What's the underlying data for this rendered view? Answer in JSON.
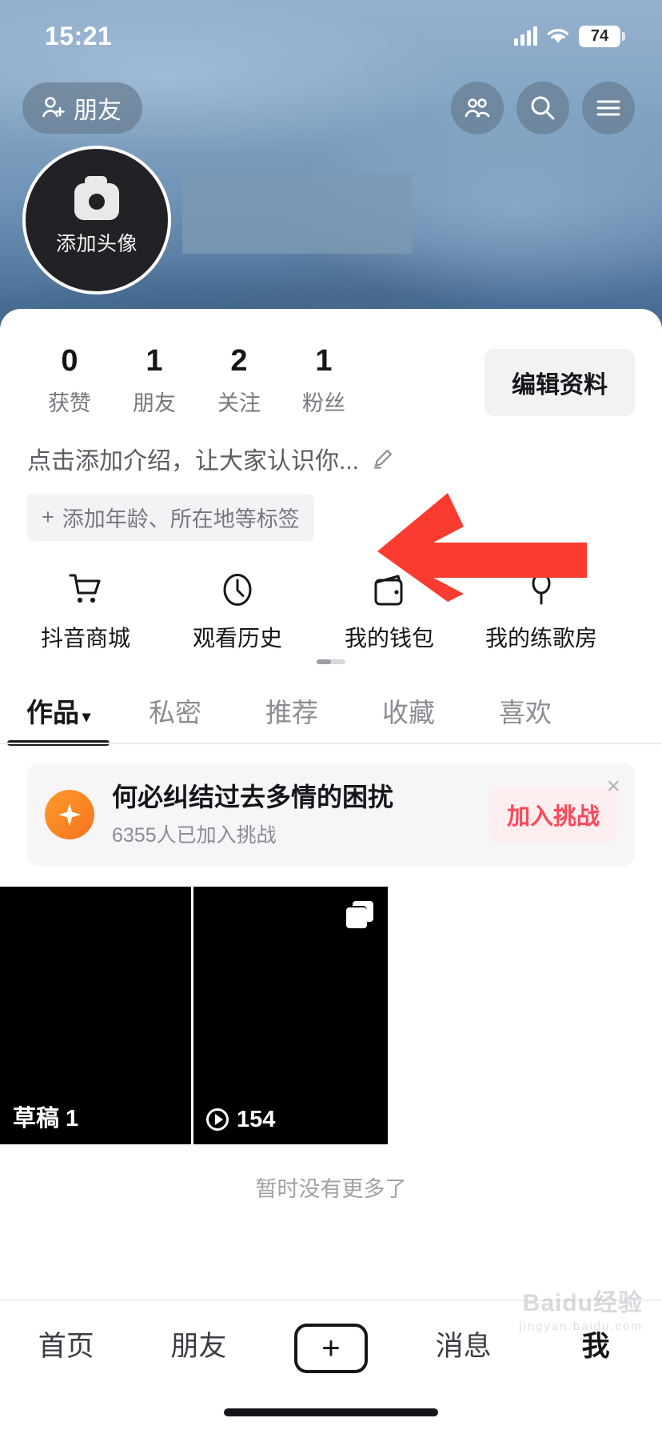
{
  "status_bar": {
    "time": "15:21",
    "battery_level": "74",
    "signal_icon": "cellular-signal-icon",
    "wifi_icon": "wifi-icon",
    "battery_icon": "battery-icon"
  },
  "top_bar": {
    "friend_button_label": "朋友",
    "friend_icon": "add-friend-icon",
    "contacts_icon": "contacts-icon",
    "search_icon": "search-icon",
    "menu_icon": "hamburger-menu-icon"
  },
  "profile": {
    "avatar_label": "添加头像",
    "avatar_icon": "camera-icon",
    "name_placeholder": "",
    "bio_text": "点击添加介绍，让大家认识你...",
    "bio_edit_icon": "pencil-icon",
    "tag_chip_label": "添加年龄、所在地等标签",
    "tag_chip_plus": "+",
    "edit_profile_label": "编辑资料",
    "stats": [
      {
        "value": "0",
        "label": "获赞"
      },
      {
        "value": "1",
        "label": "朋友"
      },
      {
        "value": "2",
        "label": "关注"
      },
      {
        "value": "1",
        "label": "粉丝"
      }
    ]
  },
  "shortcuts": [
    {
      "label": "抖音商城",
      "icon": "shopping-cart-icon"
    },
    {
      "label": "观看历史",
      "icon": "clock-icon"
    },
    {
      "label": "我的钱包",
      "icon": "wallet-icon"
    },
    {
      "label": "我的练歌房",
      "icon": "microphone-icon"
    }
  ],
  "annotation": {
    "arrow_icon": "red-left-arrow-icon",
    "arrow_color": "#fa3b30"
  },
  "content_tabs": [
    {
      "label": "作品",
      "caret": "▾",
      "active": true
    },
    {
      "label": "私密",
      "caret": "",
      "active": false
    },
    {
      "label": "推荐",
      "caret": "",
      "active": false
    },
    {
      "label": "收藏",
      "caret": "",
      "active": false
    },
    {
      "label": "喜欢",
      "caret": "",
      "active": false
    }
  ],
  "challenge_banner": {
    "badge_icon": "sparkle-icon",
    "title": "何必纠结过去多情的困扰",
    "subtitle": "6355人已加入挑战",
    "join_label": "加入挑战",
    "close_icon": "close-icon",
    "join_text_color": "#fa4a5b",
    "join_bg_color": "#feeef0"
  },
  "video_grid": [
    {
      "badge": "",
      "label": "草稿 1",
      "icon": "",
      "stack_icon": ""
    },
    {
      "badge": "multi-photo-icon",
      "label": "154",
      "icon": "play-icon",
      "stack_icon": "stack-icon"
    }
  ],
  "footer_note": "暂时没有更多了",
  "bottom_nav": [
    {
      "label": "首页",
      "type": "text",
      "active": false
    },
    {
      "label": "朋友",
      "type": "text",
      "active": false
    },
    {
      "label": "+",
      "type": "plus",
      "active": false
    },
    {
      "label": "消息",
      "type": "text",
      "active": false
    },
    {
      "label": "我",
      "type": "text",
      "active": true
    }
  ],
  "watermark": {
    "main": "Baidu经验",
    "sub": "jingyan.baidu.com"
  }
}
